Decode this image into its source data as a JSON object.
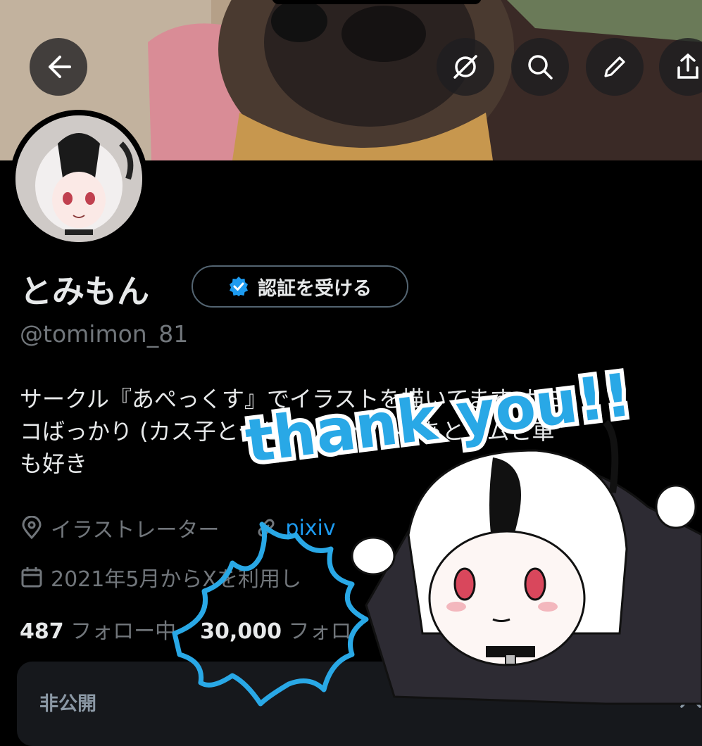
{
  "profile": {
    "display_name": "とみもん",
    "handle": "@tomimon_81",
    "verify_button_label": "認証を受ける",
    "bio_lines": [
      "サークル『あぺっくす』でイラストを描いてます カヨ",
      "コばっかり (カス子とセヒナ とシグレ) あとジムと車",
      "も好き"
    ],
    "job": "イラストレーター",
    "link": "pixiv",
    "joined": "2021年5月からXを利用し",
    "following_count": "487",
    "following_label": "フォロー中",
    "followers_count": "30,000",
    "followers_label": "フォロ"
  },
  "private_banner": {
    "label": "非公開"
  },
  "sticker": {
    "text": "thank you!!"
  },
  "icons": [
    "back-arrow-icon",
    "mute-icon",
    "search-icon",
    "pencil-icon",
    "share-icon",
    "verified-badge-icon",
    "location-icon",
    "link-icon",
    "calendar-icon",
    "close-icon"
  ],
  "colors": {
    "accent": "#1d9bf0",
    "sticker_blue": "#29a8e6",
    "background": "#000000"
  }
}
